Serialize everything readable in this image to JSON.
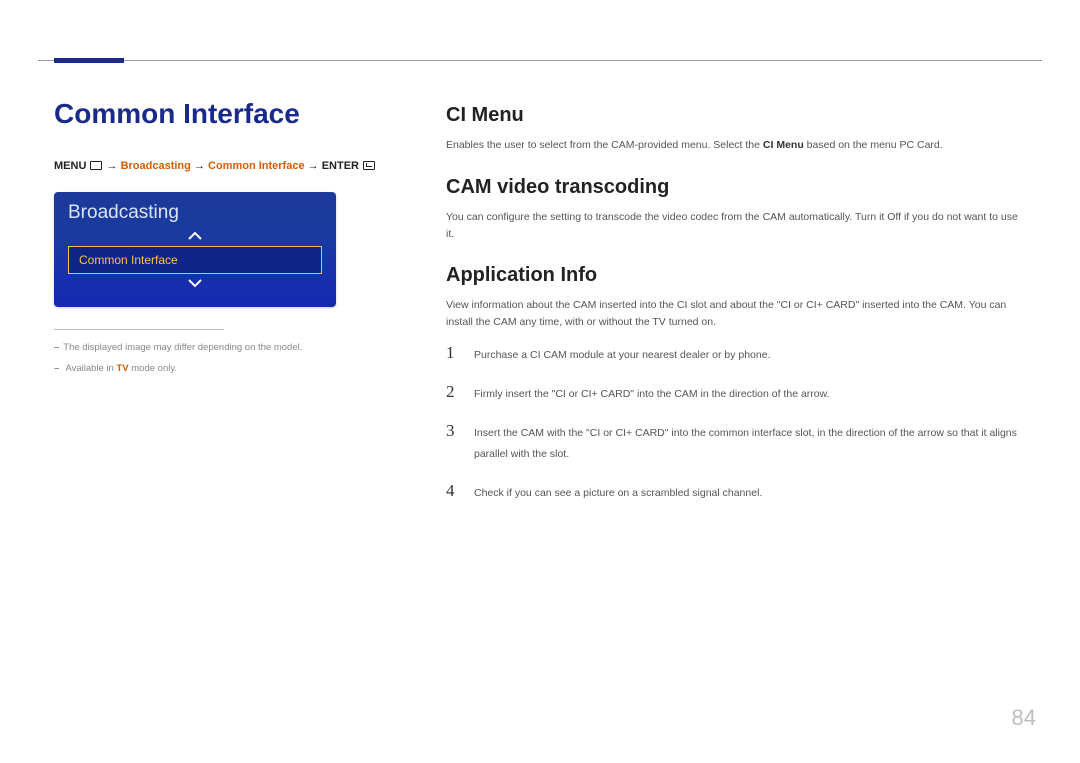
{
  "page": {
    "title": "Common Interface",
    "number": "84"
  },
  "menuPath": {
    "menu": "MENU",
    "arrow": " → ",
    "broadcasting": "Broadcasting",
    "commonInterface": "Common Interface",
    "enter": "ENTER"
  },
  "osd": {
    "title": "Broadcasting",
    "item": "Common Interface"
  },
  "footnotes": {
    "note1": "The displayed image may differ depending on the model.",
    "note2_pre": "Available in ",
    "note2_accent": "TV",
    "note2_post": " mode only."
  },
  "sections": {
    "ciMenu": {
      "title": "CI Menu",
      "body_pre": "Enables the user to select from the CAM-provided menu. Select the ",
      "body_strong": "CI Menu",
      "body_post": " based on the menu PC Card."
    },
    "camVideo": {
      "title": "CAM video transcoding",
      "body": "You can configure the setting to transcode the video codec from the CAM automatically. Turn it Off if you do not want to use it."
    },
    "appInfo": {
      "title": "Application Info",
      "body": "View information about the CAM inserted into the CI slot and about the \"CI or CI+ CARD\" inserted into the CAM. You can install the CAM any time, with or without the TV turned on.",
      "steps": [
        {
          "num": "1",
          "text": "Purchase a CI CAM module at your nearest dealer or by phone."
        },
        {
          "num": "2",
          "text": "Firmly insert the \"CI or CI+ CARD\" into the CAM in the direction of the arrow."
        },
        {
          "num": "3",
          "text": "Insert the CAM with the \"CI or CI+ CARD\" into the common interface slot, in the direction of the arrow so that it aligns parallel with the slot."
        },
        {
          "num": "4",
          "text": "Check if you can see a picture on a scrambled signal channel."
        }
      ]
    }
  }
}
